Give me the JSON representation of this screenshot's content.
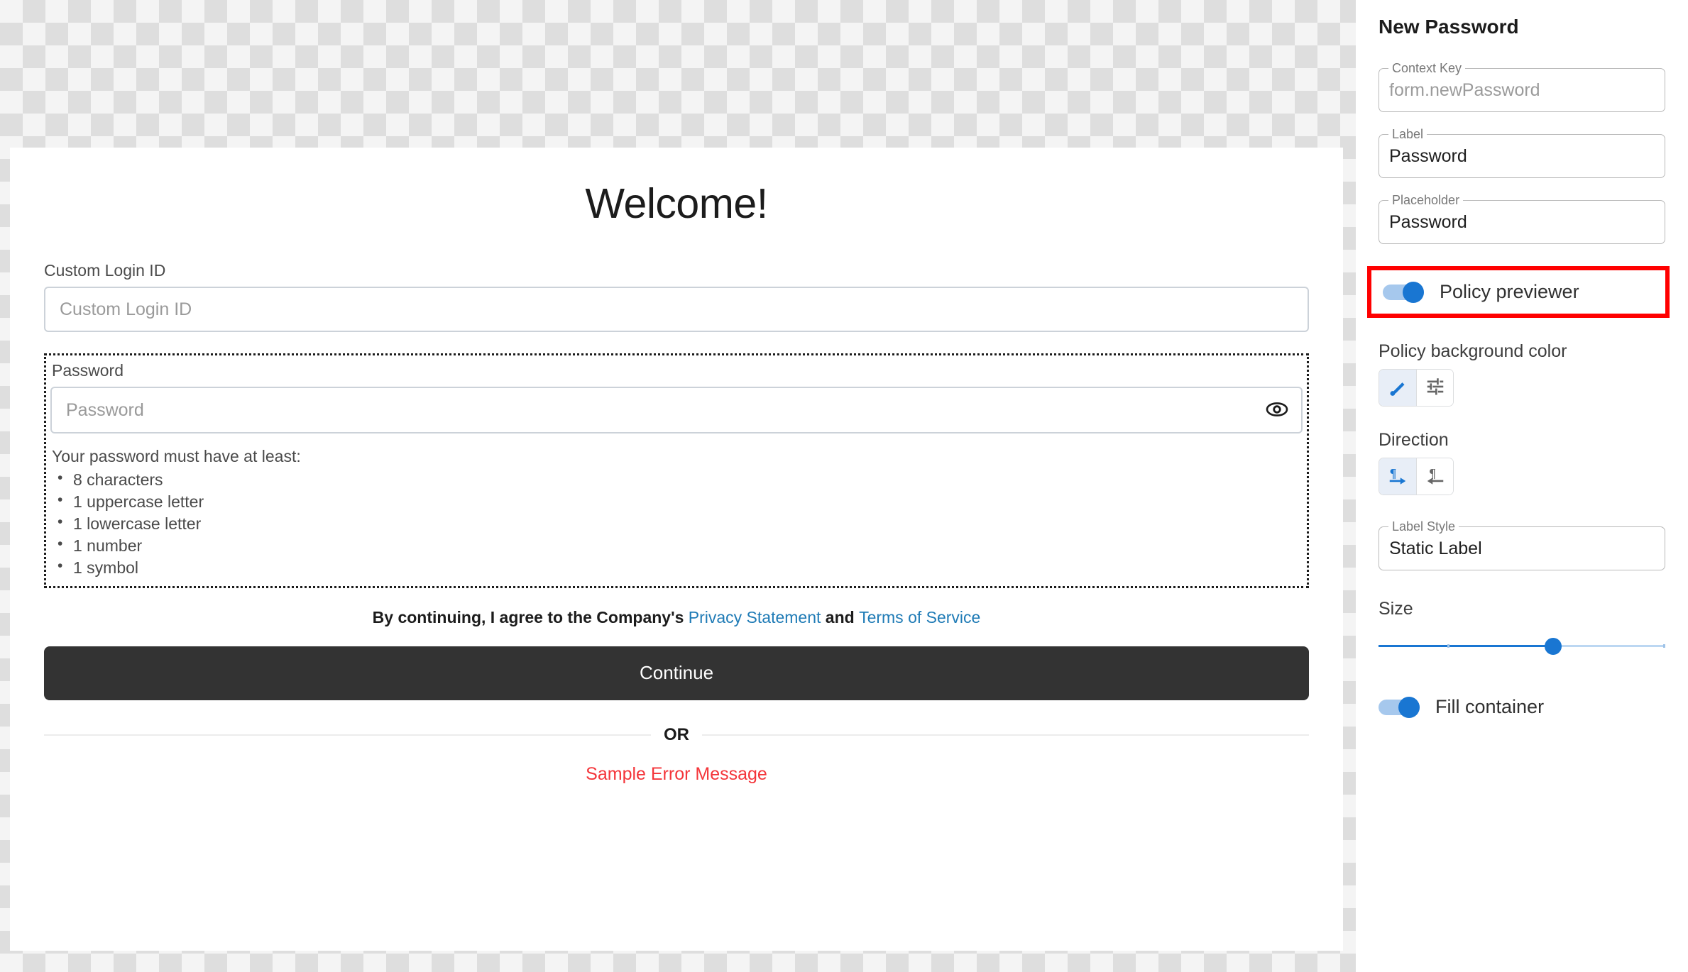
{
  "preview": {
    "heading": "Welcome!",
    "login_id": {
      "label": "Custom Login ID",
      "placeholder": "Custom Login ID",
      "value": ""
    },
    "password": {
      "label": "Password",
      "placeholder": "Password",
      "value": "",
      "reveal_icon": "eye-icon",
      "policy_title": "Your password must have at least:",
      "policy_items": [
        "8 characters",
        "1 uppercase letter",
        "1 lowercase letter",
        "1 number",
        "1 symbol"
      ]
    },
    "terms": {
      "prefix": "By continuing, I agree to the Company's ",
      "privacy_link": "Privacy Statement",
      "conjunction": " and ",
      "terms_link": "Terms of Service"
    },
    "continue_label": "Continue",
    "divider_label": "OR",
    "error_message": "Sample Error Message"
  },
  "panel": {
    "title": "New Password",
    "fields": [
      {
        "legend": "Context Key",
        "value": "form.newPassword",
        "muted": true
      },
      {
        "legend": "Label",
        "value": "Password",
        "muted": false
      },
      {
        "legend": "Placeholder",
        "value": "Password",
        "muted": false
      }
    ],
    "policy_previewer": {
      "label": "Policy previewer",
      "enabled": "on"
    },
    "policy_background_color": {
      "label": "Policy background color",
      "options": [
        {
          "icon": "brush-icon",
          "selected": "yes"
        },
        {
          "icon": "tune-sliders-icon",
          "selected": "no"
        }
      ]
    },
    "direction": {
      "label": "Direction",
      "options": [
        {
          "icon": "format-textdirection-l-to-r-icon",
          "selected": "yes"
        },
        {
          "icon": "format-textdirection-r-to-l-icon",
          "selected": "no"
        }
      ]
    },
    "label_style": {
      "legend": "Label Style",
      "value": "Static Label"
    },
    "size": {
      "label": "Size",
      "percent": 61
    },
    "fill_container": {
      "label": "Fill container",
      "enabled": "on"
    }
  },
  "colors": {
    "accent_blue": "#1976d2",
    "link_blue": "#1f7bb6",
    "error_red": "#f4353a",
    "highlight_red": "#ff0000",
    "button_dark": "#333333"
  }
}
